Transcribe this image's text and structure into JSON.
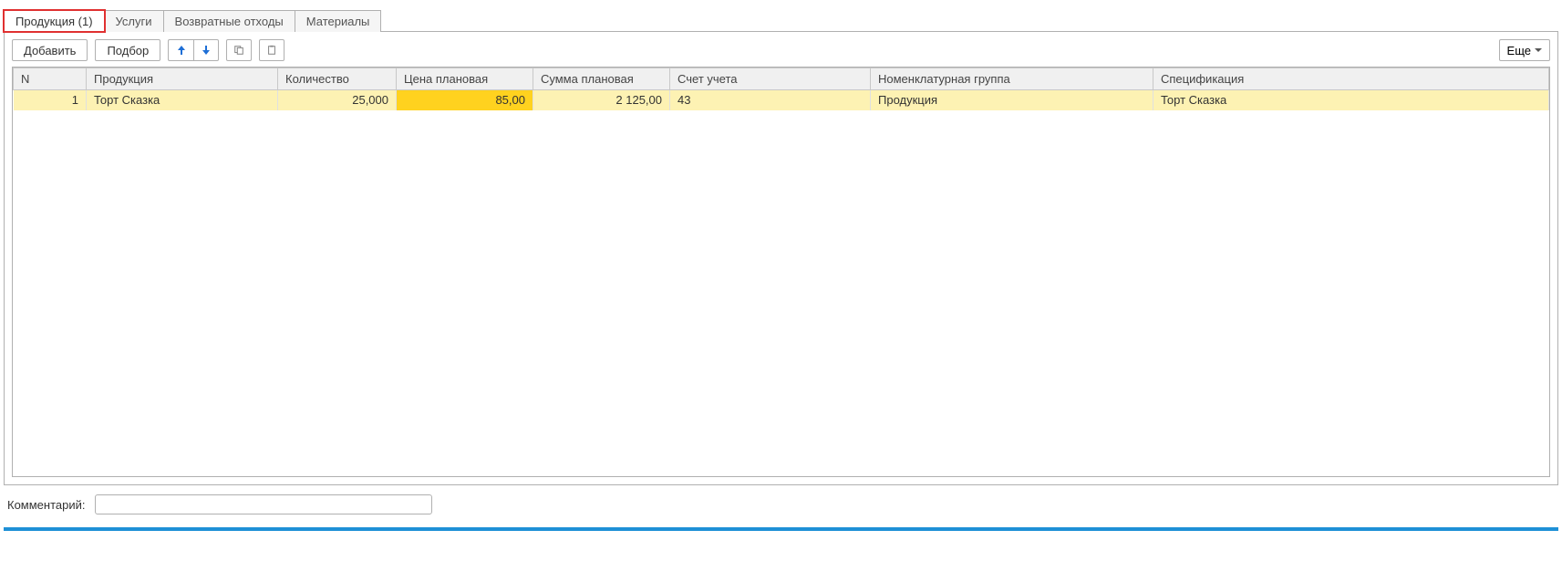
{
  "tabs": [
    {
      "label": "Продукция (1)",
      "active": true,
      "highlighted": true
    },
    {
      "label": "Услуги",
      "active": false,
      "highlighted": false
    },
    {
      "label": "Возвратные отходы",
      "active": false,
      "highlighted": false
    },
    {
      "label": "Материалы",
      "active": false,
      "highlighted": false
    }
  ],
  "toolbar": {
    "add_label": "Добавить",
    "pick_label": "Подбор",
    "more_label": "Еще"
  },
  "table": {
    "headers": {
      "n": "N",
      "product": "Продукция",
      "qty": "Количество",
      "price": "Цена плановая",
      "sum": "Сумма плановая",
      "account": "Счет учета",
      "group": "Номенклатурная группа",
      "spec": "Спецификация"
    },
    "rows": [
      {
        "n": "1",
        "product": "Торт Сказка",
        "qty": "25,000",
        "price": "85,00",
        "sum": "2 125,00",
        "account": "43",
        "group": "Продукция",
        "spec": "Торт Сказка"
      }
    ]
  },
  "comment": {
    "label": "Комментарий:",
    "value": ""
  }
}
